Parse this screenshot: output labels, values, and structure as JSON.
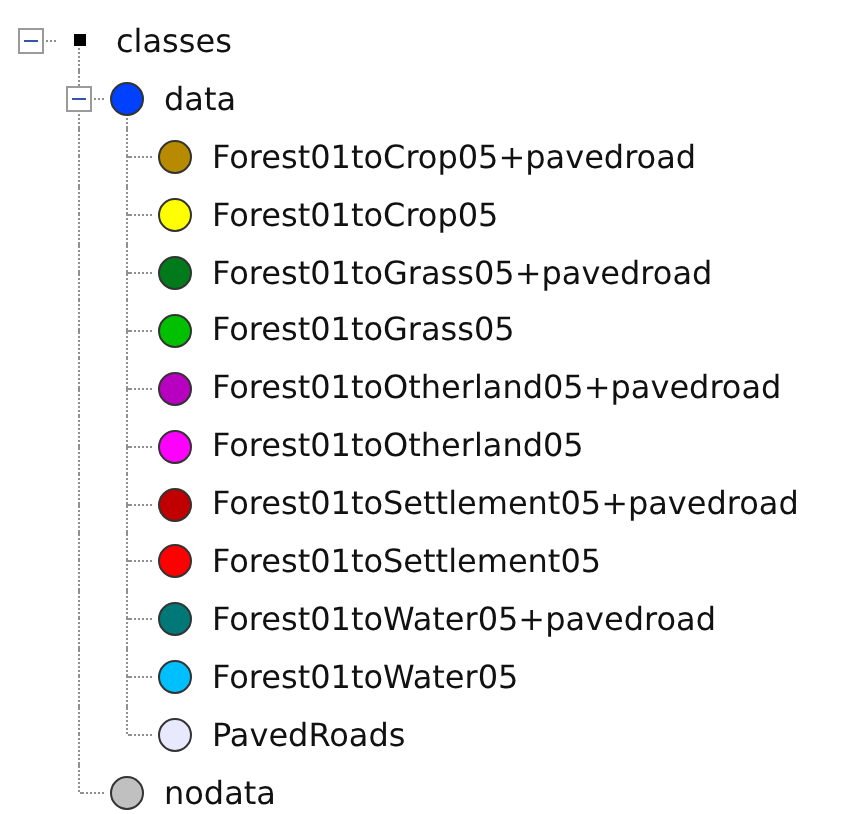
{
  "tree": [
    {
      "label": "classes",
      "kind": "square",
      "expanded": true,
      "children": [
        {
          "label": "data",
          "kind": "dot",
          "color": "#0040ff",
          "expanded": true,
          "children": [
            {
              "label": "Forest01toCrop05+pavedroad",
              "kind": "dot",
              "color": "#b88a00"
            },
            {
              "label": "Forest01toCrop05",
              "kind": "dot",
              "color": "#ffff00"
            },
            {
              "label": "Forest01toGrass05+pavedroad",
              "kind": "dot",
              "color": "#007a1a"
            },
            {
              "label": "Forest01toGrass05",
              "kind": "dot",
              "color": "#00c000"
            },
            {
              "label": "Forest01toOtherland05+pavedroad",
              "kind": "dot",
              "color": "#b800c0"
            },
            {
              "label": "Forest01toOtherland05",
              "kind": "dot",
              "color": "#ff00ff"
            },
            {
              "label": "Forest01toSettlement05+pavedroad",
              "kind": "dot",
              "color": "#c00000"
            },
            {
              "label": "Forest01toSettlement05",
              "kind": "dot",
              "color": "#ff0000"
            },
            {
              "label": "Forest01toWater05+pavedroad",
              "kind": "dot",
              "color": "#007878"
            },
            {
              "label": "Forest01toWater05",
              "kind": "dot",
              "color": "#00bfff"
            },
            {
              "label": "PavedRoads",
              "kind": "dot",
              "color": "#e8e8ff"
            }
          ]
        },
        {
          "label": "nodata",
          "kind": "dot",
          "color": "#c0c0c0"
        }
      ]
    }
  ]
}
